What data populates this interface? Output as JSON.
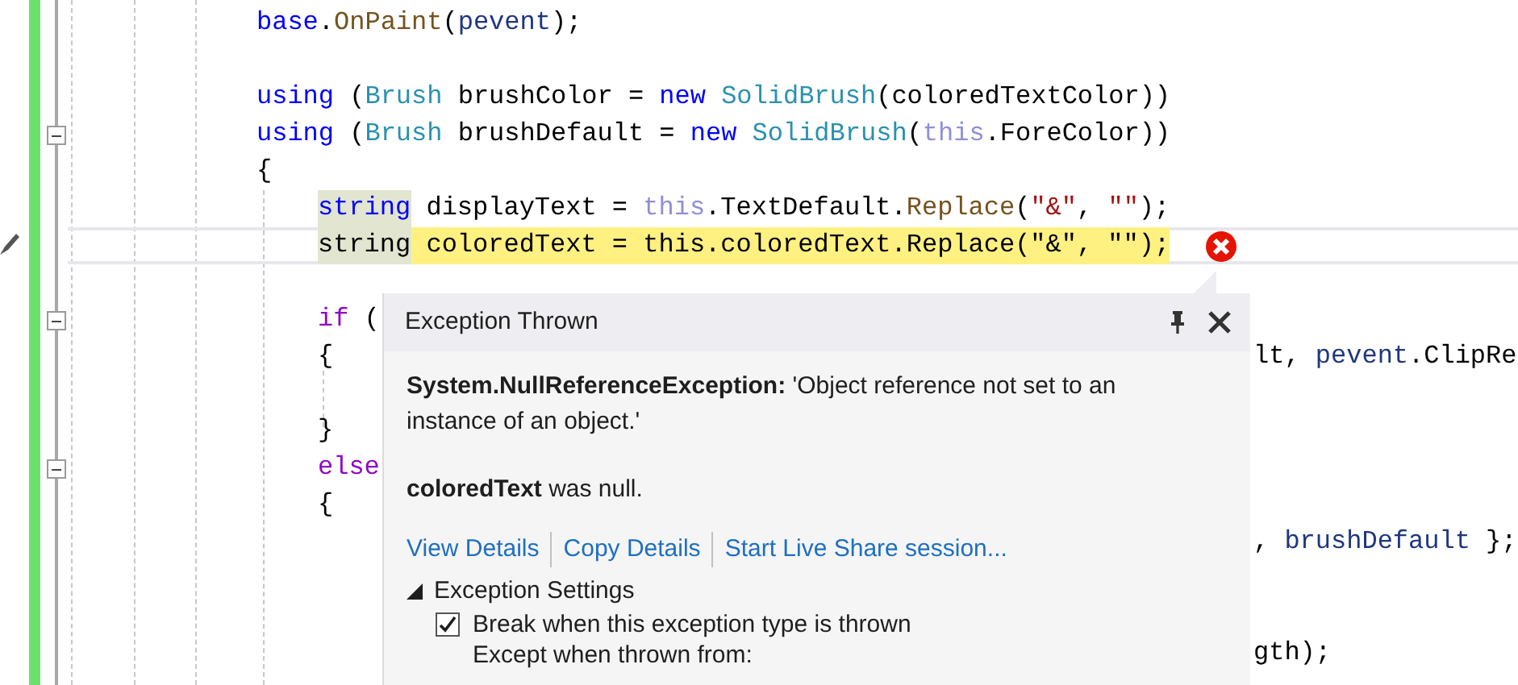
{
  "editor": {
    "lines": [
      {
        "tokens": [
          {
            "t": "base",
            "kind": "kw"
          },
          {
            "t": ".",
            "kind": "plain"
          },
          {
            "t": "OnPaint",
            "kind": "method"
          },
          {
            "t": "(",
            "kind": "plain"
          },
          {
            "t": "pevent",
            "kind": "local"
          },
          {
            "t": ");",
            "kind": "plain"
          }
        ],
        "current": false
      },
      {
        "current": false
      },
      {
        "tokens": [
          {
            "t": "using",
            "kind": "kw"
          },
          {
            "t": " (",
            "kind": "plain"
          },
          {
            "t": "Brush",
            "kind": "type"
          },
          {
            "t": " brushColor = ",
            "kind": "plain"
          },
          {
            "t": "new",
            "kind": "kw"
          },
          {
            "t": " SolidBrush",
            "kind": "type"
          },
          {
            "t": "(coloredTextColor))",
            "kind": "plain"
          }
        ],
        "current": false
      },
      {
        "tokens": [
          {
            "t": "using",
            "kind": "kw"
          },
          {
            "t": " (",
            "kind": "plain"
          },
          {
            "t": "Brush",
            "kind": "type"
          },
          {
            "t": " brushDefault = ",
            "kind": "plain"
          },
          {
            "t": "new",
            "kind": "kw"
          },
          {
            "t": " SolidBrush",
            "kind": "type"
          },
          {
            "t": "(",
            "kind": "plain"
          },
          {
            "t": "this",
            "kind": "this"
          },
          {
            "t": ".ForeColor))",
            "kind": "plain"
          }
        ],
        "current": false,
        "expanded": true
      },
      {
        "tokens": [
          {
            "t": "{",
            "kind": "plain"
          }
        ],
        "current": false
      },
      {
        "indented": true,
        "tokens": [
          {
            "t": "string",
            "kind": "kw",
            "match": true
          },
          {
            "t": " displayText = ",
            "kind": "plain"
          },
          {
            "t": "this",
            "kind": "this"
          },
          {
            "t": ".TextDefault.",
            "kind": "plain"
          },
          {
            "t": "Replace",
            "kind": "method"
          },
          {
            "t": "(",
            "kind": "plain"
          },
          {
            "t": "\"&\"",
            "kind": "str"
          },
          {
            "t": ", ",
            "kind": "plain"
          },
          {
            "t": "\"\"",
            "kind": "str"
          },
          {
            "t": ");",
            "kind": "plain"
          }
        ],
        "current": false
      },
      {
        "indented": true,
        "tokens": [
          {
            "t": "string",
            "kind": "plain",
            "match": true
          },
          {
            "t": " coloredText = this.coloredText.Replace(\"&\", \"\");",
            "kind": "plain",
            "executing": true
          }
        ],
        "current": true
      },
      {
        "current": false
      },
      {
        "indented": true,
        "tokens": [
          {
            "t": "if",
            "kind": "ctrl"
          },
          {
            "t": " (",
            "kind": "plain"
          }
        ],
        "current": false,
        "expanded": true
      },
      {
        "indented": true,
        "tokens": [
          {
            "t": "{",
            "kind": "plain"
          }
        ],
        "right": [
          {
            "t": "lt, ",
            "kind": "plain"
          },
          {
            "t": "pevent",
            "kind": "local"
          },
          {
            "t": ".ClipRe",
            "kind": "plain"
          }
        ],
        "current": false
      },
      {
        "current": false
      },
      {
        "indented": true,
        "tokens": [
          {
            "t": "}",
            "kind": "plain"
          }
        ],
        "current": false
      },
      {
        "indented": true,
        "tokens": [
          {
            "t": "else",
            "kind": "ctrl"
          }
        ],
        "current": false,
        "expanded": true
      },
      {
        "indented": true,
        "tokens": [
          {
            "t": "{",
            "kind": "plain"
          }
        ],
        "current": false
      },
      {
        "right": [
          {
            "t": ", ",
            "kind": "plain"
          },
          {
            "t": "brushDefault",
            "kind": "local"
          },
          {
            "t": " };",
            "kind": "plain"
          }
        ],
        "current": false
      },
      {
        "current": false
      },
      {
        "current": false
      },
      {
        "right": [
          {
            "t": "gth);",
            "kind": "plain"
          }
        ],
        "current": false
      }
    ]
  },
  "popup": {
    "title": "Exception Thrown",
    "message": "**System.NullReferenceException:** 'Object reference not set to an instance of an object.'",
    "detail": "**coloredText** was null.",
    "links": [
      "View Details",
      "Copy Details",
      "Start Live Share session..."
    ],
    "settings": {
      "label": "Exception Settings",
      "expanded": true,
      "options": [
        {
          "label": "Break when this exception type is thrown",
          "checked": true
        }
      ],
      "note": "Except when thrown from:"
    }
  }
}
